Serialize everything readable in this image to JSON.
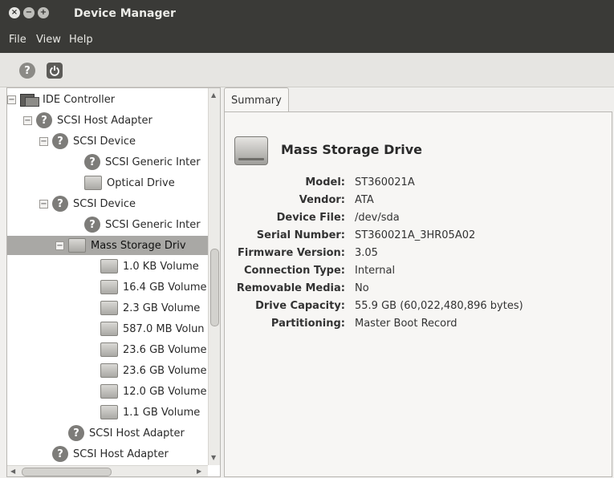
{
  "window": {
    "title": "Device Manager"
  },
  "menu": [
    "File",
    "View",
    "Help"
  ],
  "toolbar": {
    "help_icon": "help-icon",
    "power_icon": "power-icon"
  },
  "tree": {
    "rows": [
      {
        "label": "IDE Controller",
        "icon": "ide-controller-icon",
        "expander": "−"
      },
      {
        "label": "SCSI Host Adapter",
        "icon": "unknown-device-icon",
        "expander": "−"
      },
      {
        "label": "SCSI Device",
        "icon": "unknown-device-icon",
        "expander": "−"
      },
      {
        "label": "SCSI Generic Inter",
        "icon": "unknown-device-icon"
      },
      {
        "label": "Optical Drive",
        "icon": "drive-icon"
      },
      {
        "label": "SCSI Device",
        "icon": "unknown-device-icon",
        "expander": "−"
      },
      {
        "label": "SCSI Generic Inter",
        "icon": "unknown-device-icon"
      },
      {
        "label": "Mass Storage Driv",
        "icon": "drive-icon",
        "expander": "−",
        "selected": true
      },
      {
        "label": "1.0 KB Volume",
        "icon": "volume-icon"
      },
      {
        "label": "16.4 GB Volume",
        "icon": "volume-icon"
      },
      {
        "label": "2.3 GB Volume",
        "icon": "volume-icon"
      },
      {
        "label": "587.0 MB Volun",
        "icon": "volume-icon"
      },
      {
        "label": "23.6 GB Volume",
        "icon": "volume-icon"
      },
      {
        "label": "23.6 GB Volume",
        "icon": "volume-icon"
      },
      {
        "label": "12.0 GB Volume",
        "icon": "volume-icon"
      },
      {
        "label": "1.1 GB Volume",
        "icon": "volume-icon"
      },
      {
        "label": "SCSI Host Adapter",
        "icon": "unknown-device-icon"
      },
      {
        "label": "SCSI Host Adapter",
        "icon": "unknown-device-icon"
      }
    ]
  },
  "tabs": [
    {
      "label": "Summary",
      "active": true
    }
  ],
  "summary": {
    "heading": "Mass Storage Drive",
    "properties": [
      {
        "label": "Model:",
        "value": "ST360021A"
      },
      {
        "label": "Vendor:",
        "value": "ATA"
      },
      {
        "label": "Device File:",
        "value": "/dev/sda"
      },
      {
        "label": "Serial Number:",
        "value": "ST360021A_3HR05A02"
      },
      {
        "label": "Firmware Version:",
        "value": "3.05"
      },
      {
        "label": "Connection Type:",
        "value": "Internal"
      },
      {
        "label": "Removable Media:",
        "value": "No"
      },
      {
        "label": "Drive Capacity:",
        "value": "55.9 GB (60,022,480,896 bytes)"
      },
      {
        "label": "Partitioning:",
        "value": "Master Boot Record"
      }
    ]
  }
}
